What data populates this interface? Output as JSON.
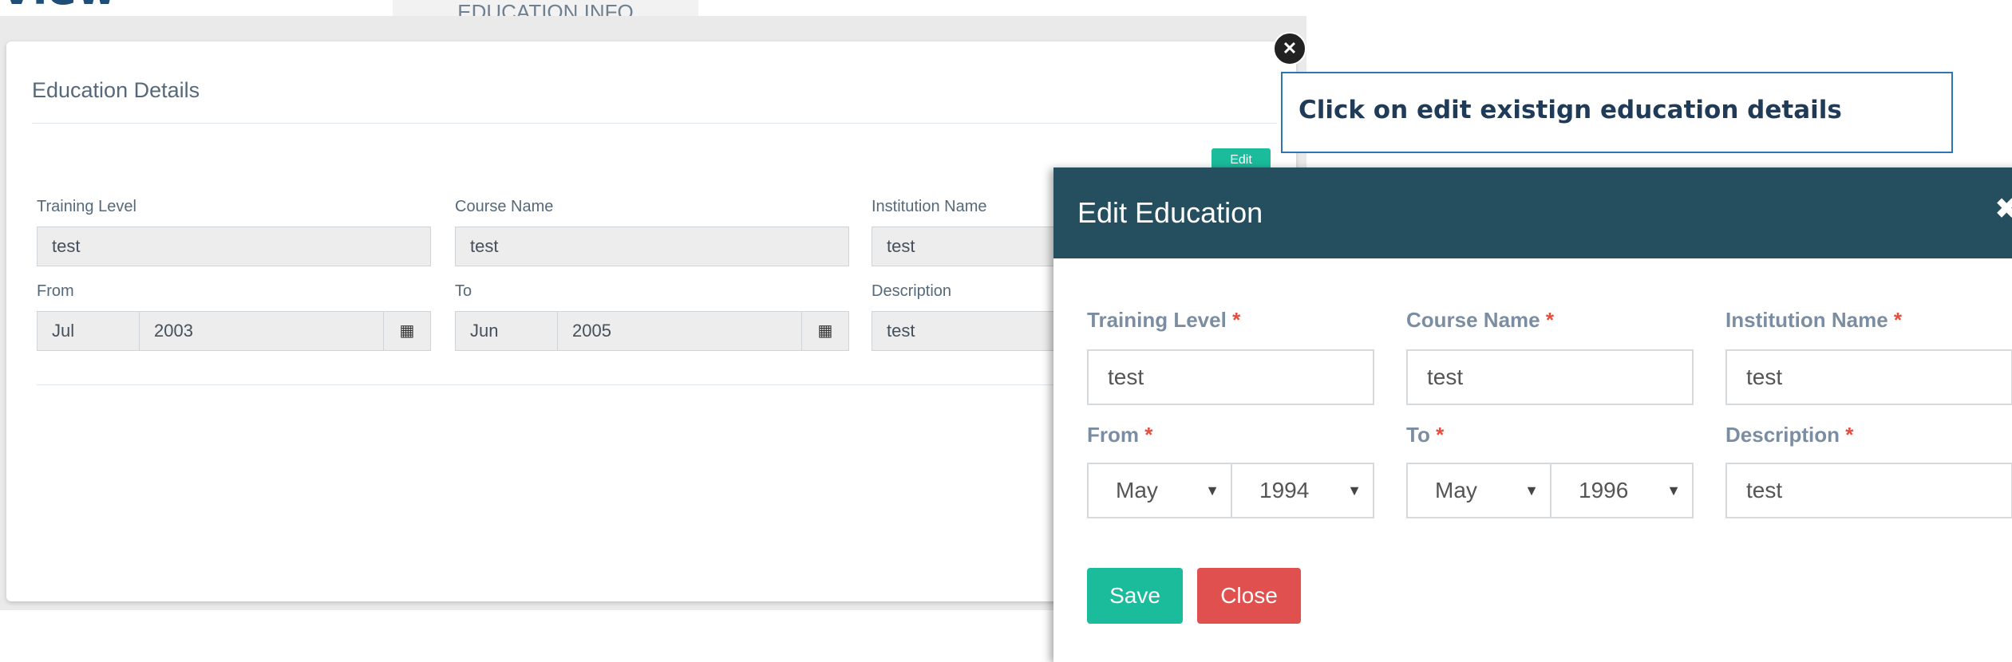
{
  "page": {
    "heading": "View"
  },
  "tab": {
    "label": "EDUCATION INFO"
  },
  "panel": {
    "title": "Education Details",
    "edit_label": "Edit",
    "fields": {
      "training_level": {
        "label": "Training Level",
        "value": "test"
      },
      "course_name": {
        "label": "Course Name",
        "value": "test"
      },
      "institution_name": {
        "label": "Institution Name",
        "value": "test"
      },
      "from": {
        "label": "From",
        "month": "Jul",
        "year": "2003",
        "icon": "calendar-icon"
      },
      "to": {
        "label": "To",
        "month": "Jun",
        "year": "2005",
        "icon": "calendar-icon"
      },
      "description": {
        "label": "Description",
        "value": "test"
      }
    }
  },
  "callout": {
    "text": "Click on edit existign education details"
  },
  "modal": {
    "title": "Edit Education",
    "close_glyph": "✖",
    "required_mark": "*",
    "fields": {
      "training_level": {
        "label": "Training Level",
        "value": "test"
      },
      "course_name": {
        "label": "Course Name",
        "value": "test"
      },
      "institution_name": {
        "label": "Institution Name",
        "value": "test"
      },
      "from": {
        "label": "From",
        "month": "May",
        "year": "1994"
      },
      "to": {
        "label": "To",
        "month": "May",
        "year": "1996"
      },
      "description": {
        "label": "Description",
        "value": "test"
      }
    },
    "save_label": "Save",
    "close_label": "Close"
  },
  "colors": {
    "modal_header": "#254f5f",
    "save_button": "#1abc9c",
    "close_button": "#e0504f",
    "required": "#e74c3c",
    "callout_border": "#2e75b6"
  }
}
